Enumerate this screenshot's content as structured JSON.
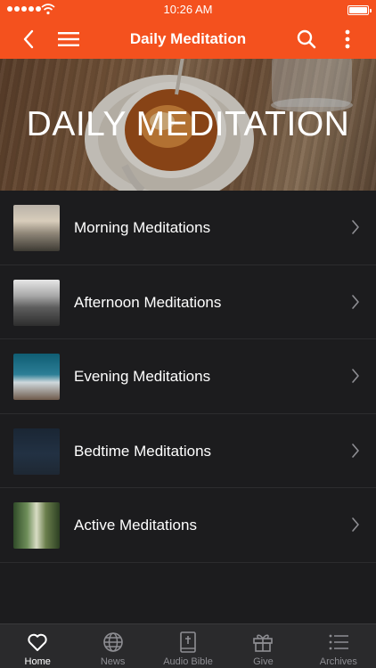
{
  "status_bar": {
    "time": "10:26 AM"
  },
  "nav": {
    "title": "Daily Meditation"
  },
  "hero": {
    "title": "DAILY MEDITATION"
  },
  "list": {
    "items": [
      {
        "label": "Morning Meditations",
        "thumb": "morning"
      },
      {
        "label": "Afternoon Meditations",
        "thumb": "afternoon"
      },
      {
        "label": "Evening Meditations",
        "thumb": "evening"
      },
      {
        "label": "Bedtime Meditations",
        "thumb": "bedtime"
      },
      {
        "label": "Active Meditations",
        "thumb": "active"
      }
    ]
  },
  "tabs": [
    {
      "label": "Home",
      "icon": "heart-icon",
      "active": true
    },
    {
      "label": "News",
      "icon": "globe-icon",
      "active": false
    },
    {
      "label": "Audio Bible",
      "icon": "bible-icon",
      "active": false
    },
    {
      "label": "Give",
      "icon": "gift-icon",
      "active": false
    },
    {
      "label": "Archives",
      "icon": "list-icon",
      "active": false
    }
  ],
  "colors": {
    "accent": "#f4511e",
    "background": "#1c1c1e",
    "tabbar": "#2a2a2c",
    "tab_inactive": "#8e8e93"
  }
}
